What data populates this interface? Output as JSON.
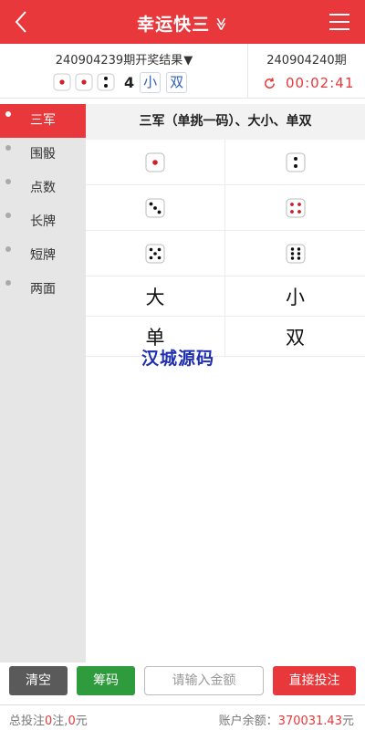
{
  "header": {
    "title": "幸运快三",
    "title_chevron": "≫",
    "colors": {
      "brand": "#e8383b"
    }
  },
  "draw": {
    "last_period_label": "240904239期开奖结果",
    "last_dice": [
      1,
      1,
      2
    ],
    "sum": "4",
    "size_tag": "小",
    "parity_tag": "双",
    "next_period_label": "240904240期",
    "countdown": "00:02:41"
  },
  "sidebar": {
    "items": [
      {
        "label": "三军",
        "active": true
      },
      {
        "label": "围骰",
        "active": false
      },
      {
        "label": "点数",
        "active": false
      },
      {
        "label": "长牌",
        "active": false
      },
      {
        "label": "短牌",
        "active": false
      },
      {
        "label": "两面",
        "active": false
      }
    ]
  },
  "main": {
    "section_title": "三军（单挑一码）、大小、单双",
    "dice_options": [
      1,
      2,
      3,
      4,
      5,
      6
    ],
    "text_options": [
      "大",
      "小",
      "单",
      "双"
    ]
  },
  "watermark": "汉城源码",
  "footer": {
    "clear_label": "清空",
    "chip_label": "筹码",
    "amount_placeholder": "请输入金额",
    "bet_label": "直接投注"
  },
  "status": {
    "total_prefix": "总投注",
    "bets": "0",
    "bets_unit": "注,",
    "amount": "0",
    "amount_unit": "元",
    "balance_label": "账户余额：",
    "balance": "370031.43",
    "balance_unit": "元"
  }
}
